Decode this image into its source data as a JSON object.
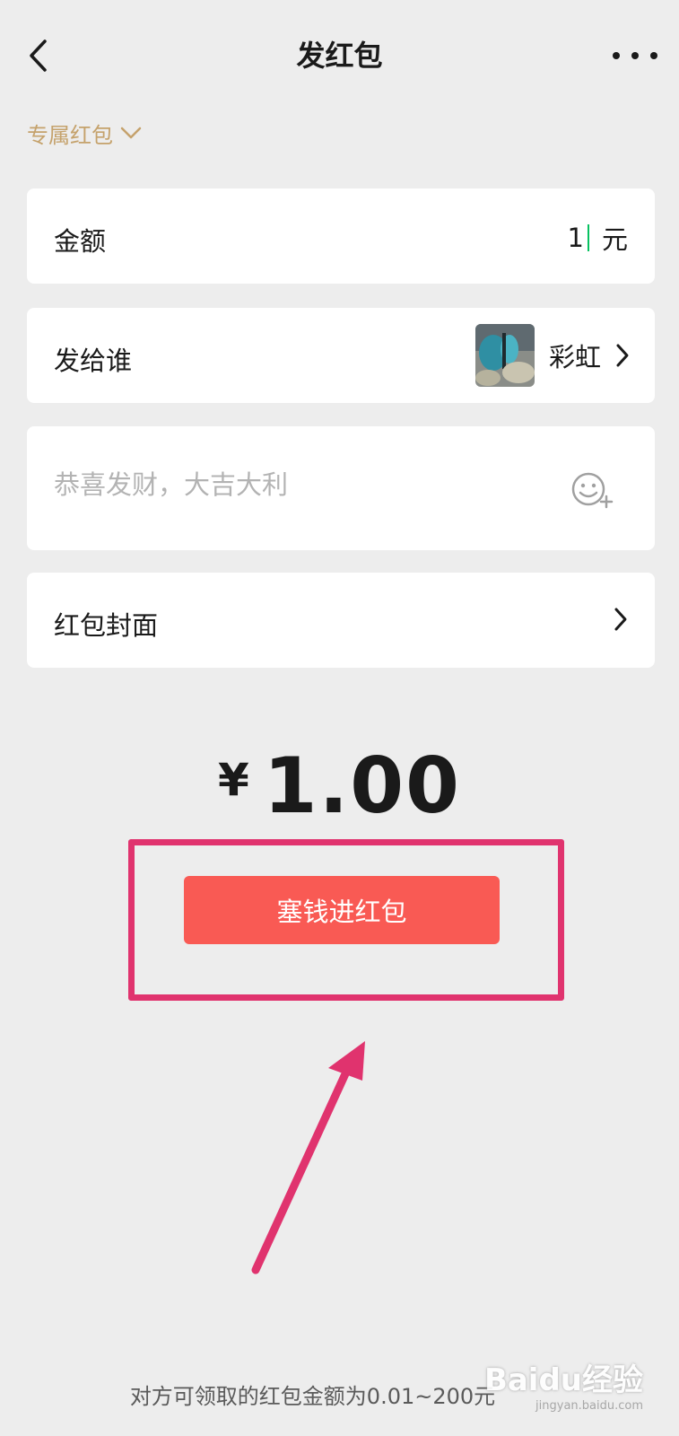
{
  "header": {
    "title": "发红包"
  },
  "packet_type": {
    "label": "专属红包"
  },
  "amount": {
    "label": "金额",
    "value": "1",
    "unit": "元"
  },
  "recipient": {
    "label": "发给谁",
    "name": "彩虹"
  },
  "message": {
    "placeholder": "恭喜发财，大吉大利",
    "value": ""
  },
  "cover": {
    "label": "红包封面"
  },
  "total": {
    "currency": "¥",
    "amount": "1.00"
  },
  "send_button": {
    "label": "塞钱进红包"
  },
  "footer": {
    "note": "对方可领取的红包金额为0.01~200元"
  },
  "watermark": {
    "logo": "Baidu经验",
    "url": "jingyan.baidu.com"
  },
  "colors": {
    "accent_gold": "#c5a26c",
    "send_button": "#f95a54",
    "annotation": "#e0336e",
    "background": "#ededed"
  }
}
